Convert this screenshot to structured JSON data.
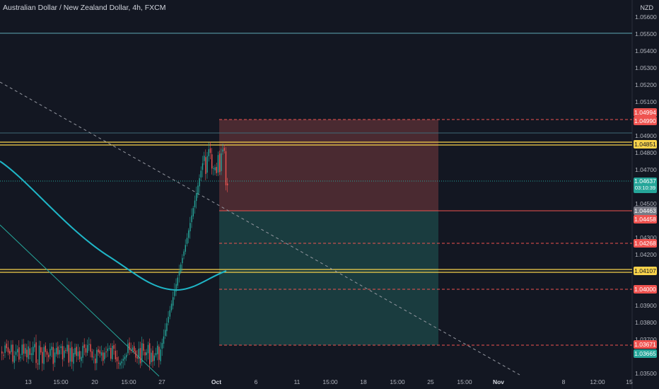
{
  "header": {
    "title": "Australian Dollar / New Zealand Dollar, 4h, FXCM",
    "currency": "NZD"
  },
  "price_axis": {
    "ticks": [
      "1.05600",
      "1.05500",
      "1.05400",
      "1.05300",
      "1.05200",
      "1.05100",
      "1.04900",
      "1.04800",
      "1.04700",
      "1.04500",
      "1.04300",
      "1.04200",
      "1.03900",
      "1.03800",
      "1.03700",
      "1.03500"
    ]
  },
  "price_tags": {
    "stop": "1.04994",
    "hline_top": "1.04990",
    "yellow_upper": "1.04851",
    "current": "1.04637",
    "countdown": "03:10:39",
    "gray": "1.04463",
    "entry": "1.04458",
    "tp1": "1.04268",
    "yellow_lower": "1.04107",
    "level_104": "1.04000",
    "tp_final": "1.03671",
    "low_mark": "1.03665"
  },
  "time_axis": {
    "ticks": [
      "13",
      "15:00",
      "20",
      "15:00",
      "27",
      "Oct",
      "6",
      "11",
      "15:00",
      "18",
      "15:00",
      "25",
      "15:00",
      "Nov",
      "8",
      "12:00",
      "15"
    ]
  },
  "colors": {
    "background": "#131722",
    "up": "#26a69a",
    "down": "#ef5350",
    "yellow": "#f7d24b",
    "ma": "#1fb6c7",
    "risk_zone": "#4a2a31",
    "reward_zone": "#1a3c3f"
  }
}
